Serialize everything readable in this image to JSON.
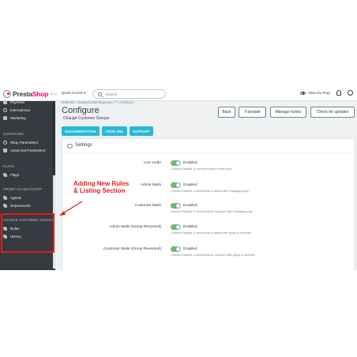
{
  "header": {
    "brand_main": "Presta",
    "brand_accent": "Shop",
    "version": "8.1.x",
    "quick_access": "Quick Access ▾",
    "search_placeholder": "Search",
    "view_shop": "View my shop"
  },
  "sidebar": {
    "items_top": [
      {
        "label": "Payment",
        "icon": "card-icon"
      },
      {
        "label": "International",
        "icon": "globe-icon"
      },
      {
        "label": "Marketing",
        "icon": "megaphone-icon"
      }
    ],
    "section_configure": "CONFIGURE",
    "configure_items": [
      {
        "label": "Shop Parameters",
        "icon": "gear-icon"
      },
      {
        "label": "Advanced Parameters",
        "icon": "desktop-icon"
      }
    ],
    "section_flags": "FLAGS",
    "flags_items": [
      {
        "label": "Flags",
        "icon": "puzzle-icon"
      }
    ],
    "section_whatsapp": "ORDER VIA WHATSAPP",
    "whatsapp_items": [
      {
        "label": "Agents",
        "icon": "puzzle-icon"
      },
      {
        "label": "Departments",
        "icon": "puzzle-icon"
      }
    ],
    "section_groups": "CHANGE CUSTOMER GROUPS",
    "groups_items": [
      {
        "label": "Rules",
        "icon": "puzzle-icon"
      },
      {
        "label": "History",
        "icon": "puzzle-icon"
      }
    ]
  },
  "main": {
    "breadcrumb": "Modules  /  changecustomergroups  /  ✎ Configure",
    "title": "Configure",
    "subtitle": "Change Customer Groups",
    "header_buttons": [
      "Back",
      "Translate",
      "Manage hooks",
      "Check for updates"
    ],
    "tabs": [
      "DOCUMENTATION",
      "CRON URL",
      "SUPPORT"
    ],
    "panel_title": "Settings",
    "settings": [
      {
        "label": "Live mode",
        "value": "Enabled",
        "help": "Choose Enabled, to use the module in live mode"
      },
      {
        "label": "Admin Mails",
        "value": "Enabled",
        "help": "Choose Enabled, to send email to admin after changing group"
      },
      {
        "label": "Customer Mails",
        "value": "Enabled",
        "help": "Choose Enabled, to send email to customer after changing group"
      },
      {
        "label": "Admin Mails (Group Reversed)",
        "value": "Enabled",
        "help": "Choose Enabled, to send email to admin after group is reversed"
      },
      {
        "label": "Customer Mails (Group Reversed)",
        "value": "Enabled",
        "help": "Choose Enabled, to send email to customer after group is reversed"
      }
    ]
  },
  "annotation": {
    "line1": "Adding New Rules",
    "line2": "& Listing Section"
  },
  "colors": {
    "accent": "#25b9d7",
    "brand": "#df0067",
    "sidebar": "#363a41",
    "toggle_on": "#70b580",
    "annotation": "#e31d1d"
  }
}
